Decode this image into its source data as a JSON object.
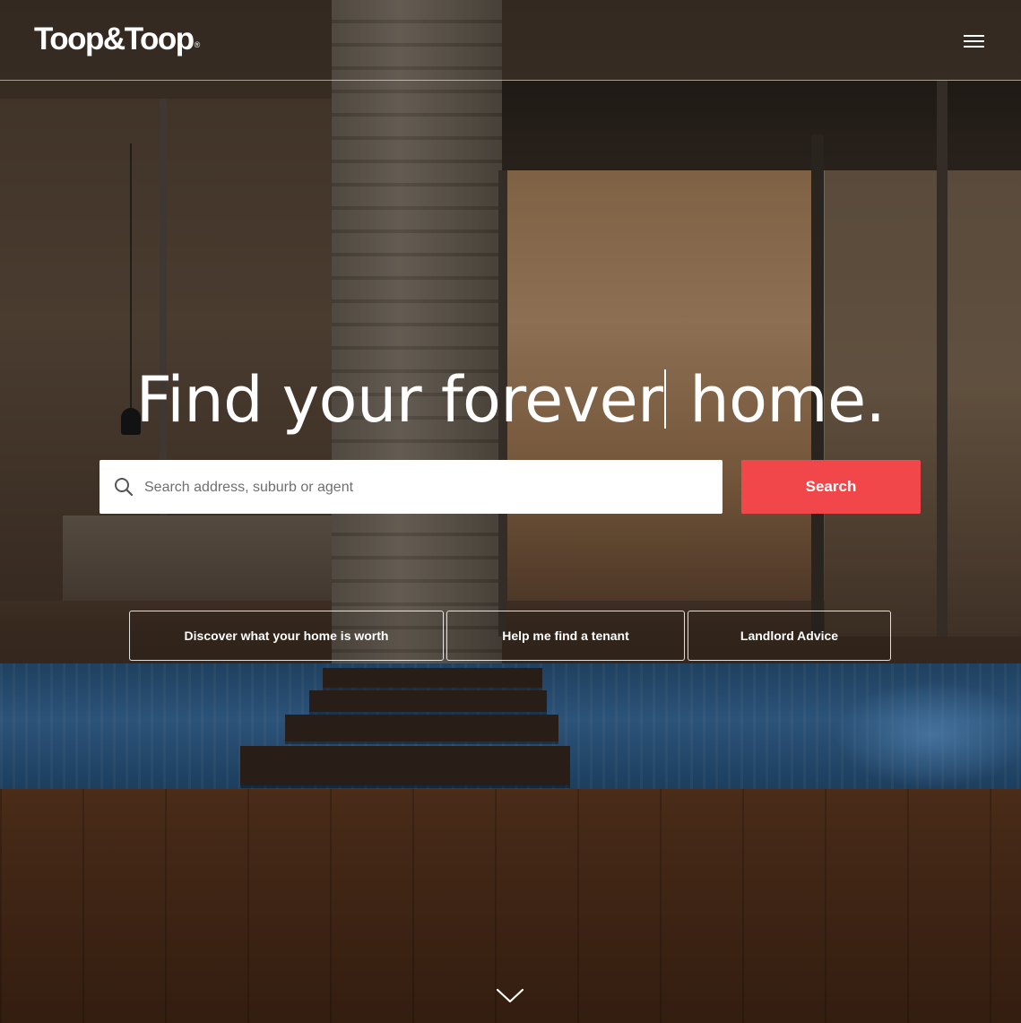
{
  "header": {
    "logo_text": "Toop&Toop",
    "logo_mark": "®",
    "menu_icon": "hamburger-menu-icon"
  },
  "hero": {
    "headline_part1": "Find your forever",
    "headline_part2": " home."
  },
  "search": {
    "placeholder": "Search address, suburb or agent",
    "value": "",
    "button_label": "Search",
    "button_color": "#f2474a",
    "icon": "search-icon"
  },
  "actions": [
    {
      "label": "Discover what your home is worth"
    },
    {
      "label": "Help me find a tenant"
    },
    {
      "label": "Landlord Advice"
    }
  ],
  "scroll": {
    "icon": "chevron-down-icon"
  }
}
